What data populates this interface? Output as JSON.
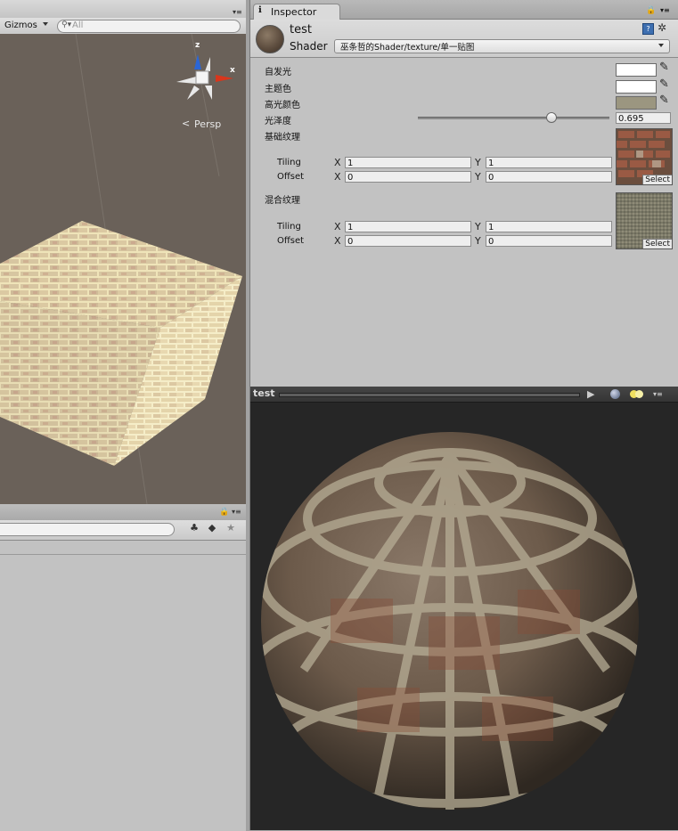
{
  "scene": {
    "gizmos_label": "Gizmos",
    "search_placeholder": "All",
    "persp_label": "Persp",
    "axis_z": "z",
    "axis_x": "x"
  },
  "inspector": {
    "tab_label": "Inspector",
    "material_name": "test",
    "shader_label": "Shader",
    "shader_value": "巫条哲的Shader/texture/单一贴图",
    "properties": {
      "emission_label": "自发光",
      "main_color_label": "主题色",
      "spec_color_label": "高光颜色",
      "gloss_label": "光泽度",
      "gloss_value": "0.695",
      "gloss_fraction": 0.695,
      "base_tex_label": "基础纹理",
      "blend_tex_label": "混合纹理"
    },
    "colors": {
      "emission": "#ffffff",
      "main": "#ffffff",
      "spec": "#9b9680"
    },
    "textures": [
      {
        "tiling_label": "Tiling",
        "offset_label": "Offset",
        "x_label": "X",
        "y_label": "Y",
        "tiling_x": "1",
        "tiling_y": "1",
        "offset_x": "0",
        "offset_y": "0",
        "select_label": "Select"
      },
      {
        "tiling_label": "Tiling",
        "offset_label": "Offset",
        "x_label": "X",
        "y_label": "Y",
        "tiling_x": "1",
        "tiling_y": "1",
        "offset_x": "0",
        "offset_y": "0",
        "select_label": "Select"
      }
    ]
  },
  "preview": {
    "title": "test"
  }
}
